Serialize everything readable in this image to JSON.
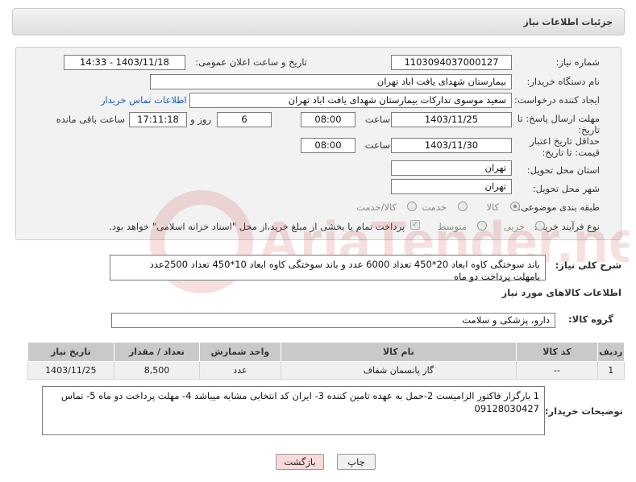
{
  "header": {
    "title": "جزئیات اطلاعات نیاز"
  },
  "form": {
    "need_number_label": "شماره نیاز:",
    "need_number_value": "1103094037000127",
    "announce_datetime_label": "تاریخ و ساعت اعلان عمومی:",
    "announce_datetime_value": "1403/11/18 - 14:33",
    "buyer_org_label": "نام دستگاه خریدار:",
    "buyer_org_value": "بیمارستان شهدای یافت اباد تهران",
    "creator_label": "ایجاد کننده درخواست:",
    "creator_value": "سعید موسوی تدارکات بیمارستان شهدای یافت اباد تهران",
    "contact_link": "اطلاعات تماس خریدار",
    "reply_deadline_label": "مهلت ارسال پاسخ: تا تاریخ:",
    "reply_date": "1403/11/25",
    "time_label": "ساعت",
    "reply_time": "08:00",
    "days_value": "6",
    "days_label": "روز و",
    "remaining_time": "17:11:18",
    "remaining_label": "ساعت باقی مانده",
    "price_validity_label": "حداقل تاریخ اعتبار قیمت: تا تاریخ:",
    "validity_date": "1403/11/30",
    "validity_time": "08:00",
    "province_label": "استان محل تحویل:",
    "province_value": "تهران",
    "city_label": "شهر محل تحویل:",
    "city_value": "تهران",
    "category_label": "طبقه بندی موضوعی:",
    "category_options": [
      "کالا",
      "خدمت",
      "کالا/خدمت"
    ],
    "process_label": "نوع فرآیند خرید :",
    "process_options": [
      "جزیی",
      "متوسط"
    ],
    "payment_note": "پرداخت تمام یا بخشی از مبلغ خرید،از محل \"اسناد خزانه اسلامی\" خواهد بود."
  },
  "description": {
    "label": "شرح کلی نیاز:",
    "line1": "باند سوختگی کاوه ابعاد  20*450 تعداد 6000 عدد و باند سوختگی کاوه  ابعاد  10*450 تعداد 2500عدد",
    "line2": "بامهلت پرداخت دو ماه"
  },
  "goods_section": {
    "title": "اطلاعات کالاهای مورد نیاز",
    "group_label": "گروه کالا:",
    "group_value": "دارو، پزشکی و سلامت"
  },
  "table": {
    "columns": [
      "ردیف",
      "کد کالا",
      "نام کالا",
      "واحد شمارش",
      "تعداد / مقدار",
      "تاریخ نیاز"
    ],
    "rows": [
      [
        "1",
        "--",
        "گاز پانسمان شفاف",
        "عدد",
        "8,500",
        "1403/11/25"
      ]
    ]
  },
  "buyer_notes": {
    "label": "توضیحات خریدار:",
    "line1": "1 بارگزار فاکتور الزامیست 2-حمل به  عهده تامین کننده 3- ایران کد انتخابی مشابه میباشد 4- مهلت پرداخت دو ماه 5- تماس",
    "line2": "09128030427"
  },
  "buttons": {
    "print": "چاپ",
    "back": "بازگشت"
  },
  "watermark": {
    "text": "AriaTender.neT"
  }
}
